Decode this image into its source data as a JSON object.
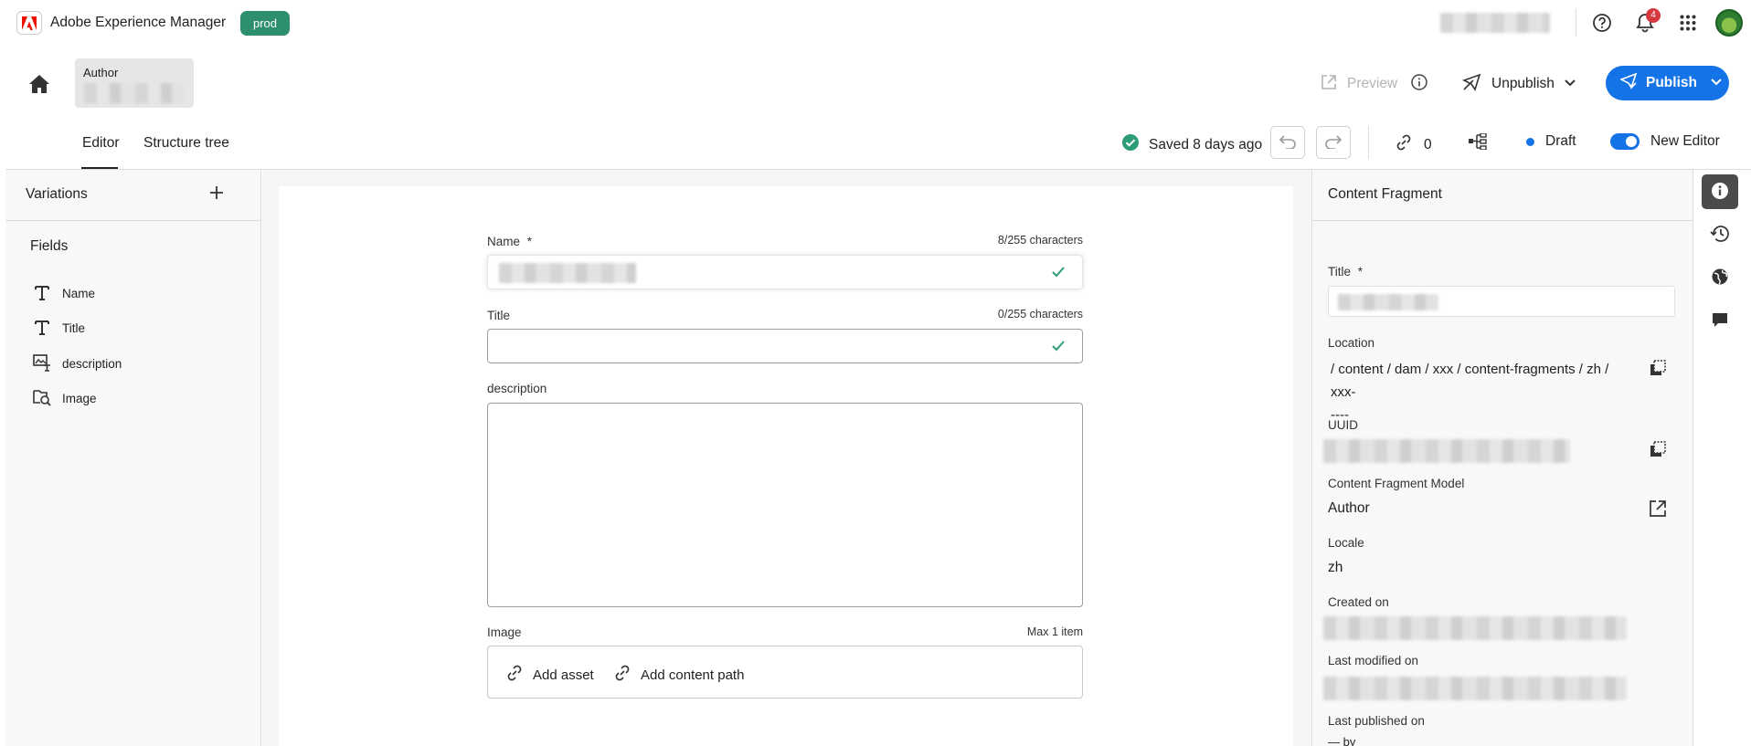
{
  "app": {
    "name": "Adobe Experience Manager",
    "environment": "prod"
  },
  "topbar": {
    "notifications_count": "4"
  },
  "breadcrumb": {
    "label": "Author"
  },
  "actions": {
    "preview": "Preview",
    "unpublish": "Unpublish",
    "publish": "Publish"
  },
  "tabs": [
    {
      "label": "Editor"
    },
    {
      "label": "Structure tree"
    }
  ],
  "status": {
    "saved": "Saved 8 days ago",
    "references_count": "0",
    "draft": "Draft",
    "new_editor": "New Editor"
  },
  "left_panel": {
    "variations": "Variations",
    "fields_title": "Fields",
    "fields": [
      {
        "label": "Name",
        "icon": "text-icon"
      },
      {
        "label": "Title",
        "icon": "text-icon"
      },
      {
        "label": "description",
        "icon": "rich-text-icon"
      },
      {
        "label": "Image",
        "icon": "asset-search-icon"
      }
    ]
  },
  "form": {
    "name": {
      "label": "Name",
      "required_mark": "*",
      "count": "8/255 characters"
    },
    "title": {
      "label": "Title",
      "count": "0/255 characters"
    },
    "description": {
      "label": "description"
    },
    "image": {
      "label": "Image",
      "max": "Max 1 item",
      "add_asset": "Add asset",
      "add_content_path": "Add content path"
    }
  },
  "right_panel": {
    "title": "Content Fragment",
    "title_label": "Title",
    "required_mark": "*",
    "location_label": "Location",
    "location_value": "/ content / dam / xxx / content-fragments / zh / xxx-\n----",
    "uuid_label": "UUID",
    "model_label": "Content Fragment Model",
    "model_value": "Author",
    "locale_label": "Locale",
    "locale_value": "zh",
    "created_label": "Created on",
    "modified_label": "Last modified on",
    "published_label": "Last published on",
    "published_value": "— by"
  },
  "colors": {
    "accent": "#1473e6",
    "env_badge": "#2d8f6f",
    "success": "#2d9d78",
    "danger": "#d7373f"
  }
}
